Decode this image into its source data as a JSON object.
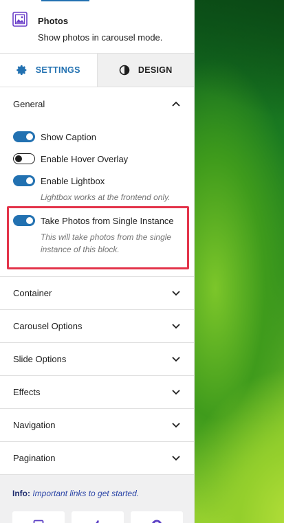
{
  "block": {
    "title": "Photos",
    "description": "Show photos in carousel mode."
  },
  "tabs": [
    {
      "label": "SETTINGS",
      "icon": "gear-icon",
      "active": true
    },
    {
      "label": "DESIGN",
      "icon": "half-circle-icon",
      "active": false
    }
  ],
  "general": {
    "title": "General",
    "toggles": [
      {
        "label": "Show Caption",
        "on": true
      },
      {
        "label": "Enable Hover Overlay",
        "on": false
      },
      {
        "label": "Enable Lightbox",
        "on": true
      },
      {
        "label": "Take Photos from Single Instance",
        "on": true
      }
    ],
    "lightbox_help": "Lightbox works at the frontend only.",
    "single_help_1": "This will take photos from the single",
    "single_help_2": "instance of this block."
  },
  "sections": [
    "Container",
    "Carousel Options",
    "Slide Options",
    "Effects",
    "Navigation",
    "Pagination"
  ],
  "info": {
    "label": "Info:",
    "message": "Important links to get started."
  },
  "info_cards": [
    "video-icon",
    "thumbs-up-icon",
    "question-icon"
  ],
  "colors": {
    "accent": "#2271b1",
    "highlight": "#e3344a",
    "info_bg": "#f0f0f1"
  }
}
